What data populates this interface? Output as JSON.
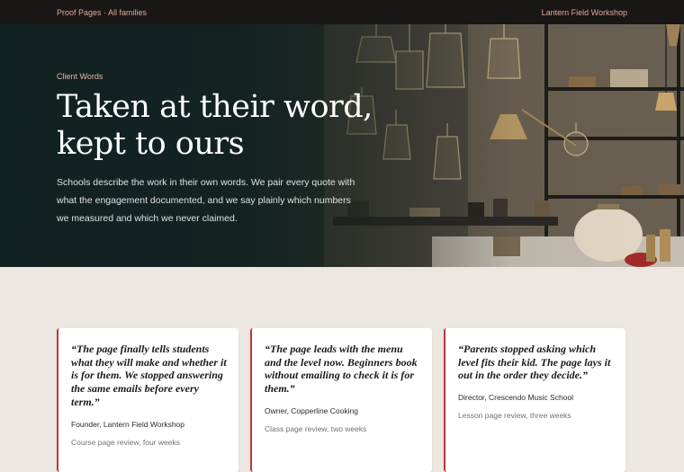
{
  "nav": {
    "left_link": "Proof Pages · All families",
    "right_link": "Lantern Field Workshop"
  },
  "hero": {
    "eyebrow": "Client Words",
    "title": "Taken at their word, kept to ours",
    "body": "Schools describe the work in their own words. We pair every quote with what the engagement documented, and we say plainly which numbers we measured and which we never claimed."
  },
  "testimonials": [
    {
      "quote": "“The page finally tells students what they will make and whether it is for them. We stopped answering the same emails before every term.”",
      "author": "Founder, Lantern Field Workshop",
      "note": "Course page review, four weeks"
    },
    {
      "quote": "“The page leads with the menu and the level now. Beginners book without emailing to check it is for them.”",
      "author": "Owner, Copperline Cooking",
      "note": "Class page review, two weeks"
    },
    {
      "quote": "“Parents stopped asking which level fits their kid. The page lays it out in the order they decide.”",
      "author": "Director, Crescendo Music School",
      "note": "Lesson page review, three weeks"
    }
  ],
  "colors": {
    "accent": "#b83a3e",
    "nav_link": "#e0a79c",
    "hero_bg": "#152524",
    "page_bg": "#ece8e1"
  }
}
